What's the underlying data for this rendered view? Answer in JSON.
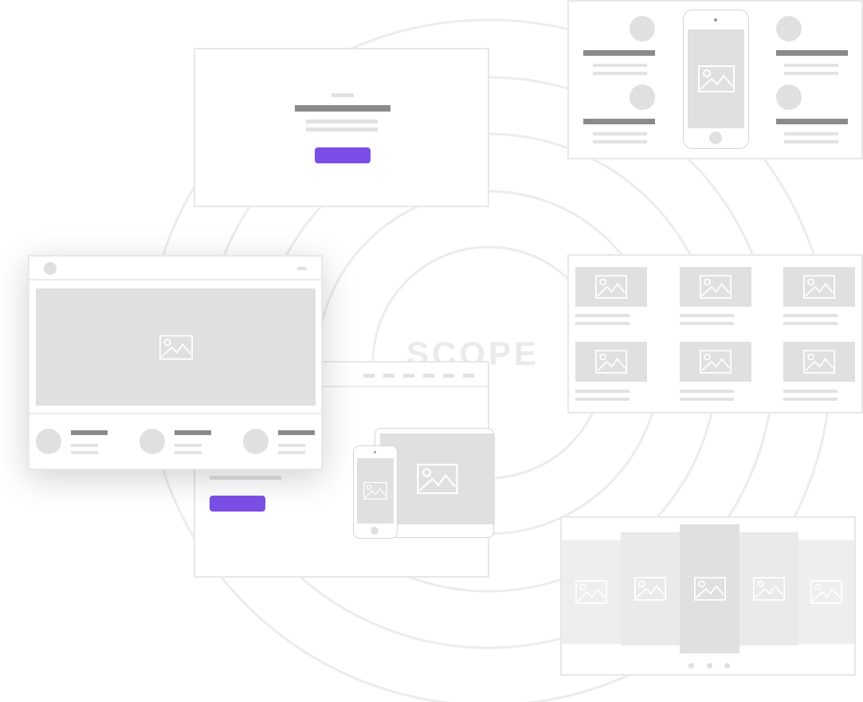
{
  "logo_text": "SCOPE",
  "colors": {
    "accent": "#7b4fe6",
    "placeholder": "#e0e0e0",
    "text_bar": "#8a8a8a",
    "light_bar": "#e2e2e2"
  },
  "icons": [
    "image-placeholder-icon",
    "phone-icon",
    "tablet-icon"
  ],
  "carousel": {
    "slides": 5,
    "dots": 3
  }
}
